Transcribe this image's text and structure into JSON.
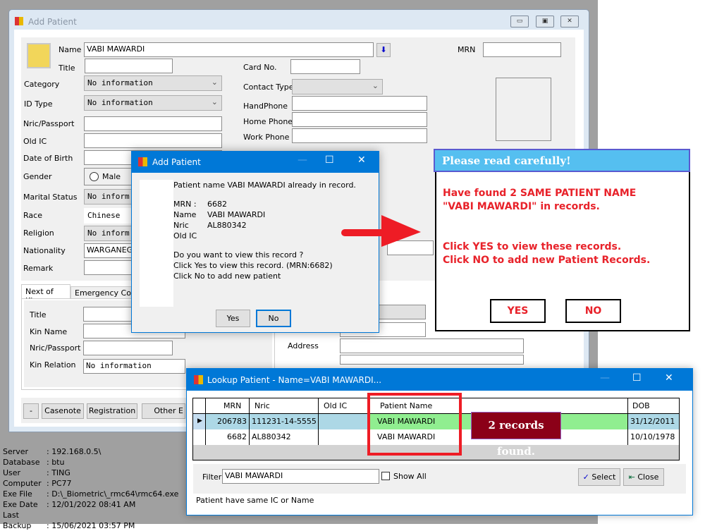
{
  "main_window": {
    "title": "Add Patient",
    "fields": {
      "name_label": "Name",
      "name_value": "VABI MAWARDI",
      "title_label": "Title",
      "mrn_label": "MRN",
      "card_label": "Card No.",
      "category_label": "Category",
      "category_value": "No information",
      "idtype_label": "ID Type",
      "idtype_value": "No information",
      "contact_type_label": "Contact Type",
      "handphone_label": "HandPhone",
      "homephone_label": "Home Phone",
      "workphone_label": "Work Phone",
      "nric_label": "Nric/Passport",
      "oldic_label": "Old IC",
      "dob_label": "Date of Birth",
      "gender_label": "Gender",
      "gender_option": "Male",
      "marital_label": "Marital Status",
      "marital_value": "No inform",
      "race_label": "Race",
      "race_value": "Chinese",
      "religion_label": "Religion",
      "religion_value": "No inform",
      "nationality_label": "Nationality",
      "nationality_value": "WARGANEGA",
      "remark_label": "Remark",
      "address_label": "Address",
      "partial_value": "one"
    },
    "tabs": [
      "Next of Kins",
      "Emergency Cont"
    ],
    "kin": {
      "title_label": "Title",
      "name_label": "Kin Name",
      "nric_label": "Nric/Passport",
      "relation_label": "Kin Relation",
      "relation_value": "No information"
    },
    "buttons": [
      "-",
      "Casenote",
      "Registration",
      "Other E"
    ]
  },
  "status": [
    {
      "k": "Server",
      "v": ": 192.168.0.5\\"
    },
    {
      "k": "Database",
      "v": ": btu"
    },
    {
      "k": "User",
      "v": ": TING"
    },
    {
      "k": "Computer",
      "v": ": PC77"
    },
    {
      "k": "Exe File",
      "v": ": D:\\_Biometric\\_rmc64\\rmc64.exe"
    },
    {
      "k": "Exe Date",
      "v": ": 12/01/2022 08:41 AM"
    },
    {
      "k": "Last Backup",
      "v": ": 15/06/2021 03:57 PM"
    }
  ],
  "dialog": {
    "title": "Add Patient",
    "line1": "Patient name VABI MAWARDI already in record.",
    "mrn_label": "MRN  :",
    "mrn": "6682",
    "name_label": "Name",
    "name": "VABI MAWARDI",
    "nric_label": "Nric",
    "nric": "AL880342",
    "oldic_label": "Old IC",
    "q": "Do you want to view this record ?",
    "yes_line": "Click  Yes  to view this record. (MRN:6682)",
    "no_line": "Click  No   to add new patient",
    "yes": "Yes",
    "no": "No"
  },
  "popup": {
    "title": "Please read carefully!",
    "l1": "Have found 2 SAME PATIENT NAME",
    "l2": "\"VABI MAWARDI\" in records.",
    "l3": "Click YES to view these records.",
    "l4": "Click NO to add new Patient Records.",
    "yes": "YES",
    "no": "NO"
  },
  "lookup": {
    "title": "Lookup Patient - Name=VABI MAWARDI...",
    "columns": [
      "MRN",
      "Nric",
      "Old IC",
      "Patient Name",
      "DOB"
    ],
    "rows": [
      {
        "mrn": "206783",
        "nric": "111231-14-5555",
        "oldic": "",
        "name": "VABI MAWARDI",
        "dob": "31/12/2011"
      },
      {
        "mrn": "6682",
        "nric": "AL880342",
        "oldic": "",
        "name": "VABI MAWARDI",
        "dob": "10/10/1978"
      }
    ],
    "badge": "2 records found.",
    "filter_label": "Filter",
    "filter_value": "VABI MAWARDI",
    "show_all": "Show All",
    "select": "Select",
    "close": "Close",
    "footer": "Patient have same IC or Name"
  },
  "colors": {
    "title_blue": "#0078d7",
    "selected_row": "#add8e6",
    "name_highlight": "#90ee90",
    "badge": "#8b0018",
    "alert_red": "#e8222a",
    "highlight_box": "#ee1c25"
  }
}
